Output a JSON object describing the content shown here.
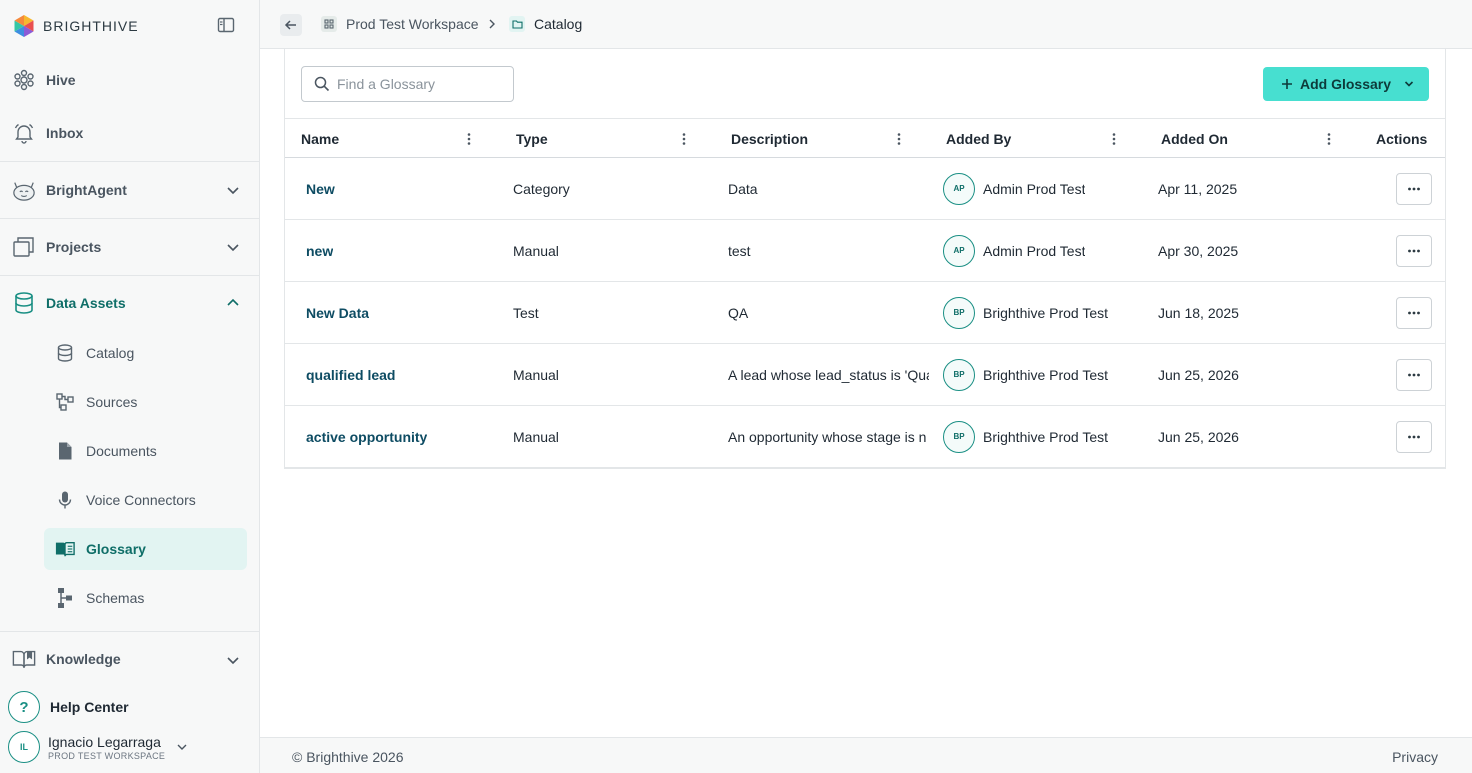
{
  "brand": {
    "name": "BRIGHTHIVE"
  },
  "sidebar": {
    "hive": "Hive",
    "inbox": "Inbox",
    "brightagent": "BrightAgent",
    "projects": "Projects",
    "data_assets": "Data Assets",
    "sub_items": [
      "Catalog",
      "Sources",
      "Documents",
      "Voice Connectors",
      "Glossary",
      "Schemas"
    ],
    "knowledge": "Knowledge",
    "help_icon": "?",
    "help": "Help Center",
    "user": {
      "initials": "IL",
      "name": "Ignacio Legarraga",
      "workspace": "PROD TEST WORKSPACE"
    }
  },
  "breadcrumb": {
    "workspace": "Prod Test Workspace",
    "current": "Catalog"
  },
  "search": {
    "placeholder": "Find a Glossary",
    "value": ""
  },
  "add_button": {
    "label": "Add Glossary"
  },
  "table": {
    "columns": [
      "Name",
      "Type",
      "Description",
      "Added By",
      "Added On",
      "Actions"
    ],
    "rows": [
      {
        "name": "New",
        "type": "Category",
        "description": "Data",
        "initials": "AP",
        "added_by": "Admin Prod Test",
        "added_on": "Apr 11, 2025"
      },
      {
        "name": "new",
        "type": "Manual",
        "description": "test",
        "initials": "AP",
        "added_by": "Admin Prod Test",
        "added_on": "Apr 30, 2025"
      },
      {
        "name": "New Data",
        "type": "Test",
        "description": "QA",
        "initials": "BP",
        "added_by": "Brighthive Prod Test",
        "added_on": "Jun 18, 2025"
      },
      {
        "name": "qualified lead",
        "type": "Manual",
        "description": "A lead whose lead_status is 'Qua",
        "initials": "BP",
        "added_by": "Brighthive Prod Test",
        "added_on": "Jun 25, 2026"
      },
      {
        "name": "active opportunity",
        "type": "Manual",
        "description": "An opportunity whose stage is n",
        "initials": "BP",
        "added_by": "Brighthive Prod Test",
        "added_on": "Jun 25, 2026"
      }
    ]
  },
  "footer": {
    "copyright": "© Brighthive 2026",
    "privacy": "Privacy"
  },
  "colors": {
    "accent": "#47dfd0",
    "link": "#0e4c63",
    "active_bg": "#e2f4f2",
    "active_text": "#0f6e68"
  },
  "icons": [
    "hive-icon",
    "bell-icon",
    "robot-icon",
    "folders-icon",
    "database-icon",
    "catalog-icon",
    "sources-icon",
    "document-icon",
    "microphone-icon",
    "book-icon",
    "schema-icon",
    "open-book-icon",
    "search-icon",
    "plus-icon",
    "chevron-down-icon",
    "more-horizontal-icon",
    "kebab-icon",
    "arrow-left-icon"
  ]
}
